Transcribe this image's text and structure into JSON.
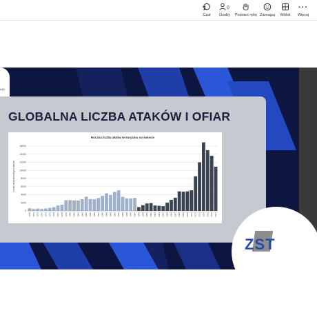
{
  "toolbar": {
    "items": [
      {
        "label": "Czat",
        "icon": "chat-icon"
      },
      {
        "label": "Osoby",
        "icon": "people-icon",
        "count": "0"
      },
      {
        "label": "Podnieś rękę",
        "icon": "raise-hand-icon"
      },
      {
        "label": "Zareaguj",
        "icon": "react-icon"
      },
      {
        "label": "Widok",
        "icon": "view-icon"
      },
      {
        "label": "Więcej",
        "icon": "more-icon"
      }
    ]
  },
  "slide": {
    "title": "GLOBALNA LICZBA ATAKÓW I OFIAR",
    "logo_text": "ZST",
    "side_text": "ALK"
  },
  "colors": {
    "slide_background": "#0d1640",
    "accent_blue": "#2b56d8",
    "panel": "#c7c9d1",
    "bar_light": "#9fb1c8",
    "bar_dark": "#3b4452"
  },
  "chart_data": {
    "type": "bar",
    "title": "Roczna liczba aktów terroryzmu na świecie",
    "ylabel": "Liczba zarejestrowanych ataków",
    "ylim": [
      0,
      17000
    ],
    "yticks": [
      0,
      2000,
      4000,
      6000,
      8000,
      10000,
      12000,
      14000,
      16000
    ],
    "categories": [
      "1970",
      "1971",
      "1972",
      "1973",
      "1974",
      "1975",
      "1976",
      "1977",
      "1978",
      "1979",
      "1980",
      "1981",
      "1982",
      "1983",
      "1984",
      "1985",
      "1986",
      "1987",
      "1988",
      "1989",
      "1990",
      "1991",
      "1992",
      "1994",
      "1995",
      "1996",
      "1997",
      "1998",
      "1999",
      "2000",
      "2001",
      "2002",
      "2003",
      "2004",
      "2005",
      "2006",
      "2007",
      "2008",
      "2009",
      "2010",
      "2011",
      "2012",
      "2013",
      "2014",
      "2015",
      "2016",
      "2017"
    ],
    "values": [
      650,
      470,
      570,
      470,
      580,
      740,
      920,
      1320,
      1520,
      2650,
      2660,
      2590,
      2540,
      2870,
      3500,
      2910,
      2860,
      3180,
      3700,
      4320,
      3890,
      4680,
      5070,
      3460,
      3080,
      3060,
      3200,
      930,
      1400,
      1820,
      1900,
      1330,
      1260,
      1170,
      2020,
      2740,
      3240,
      4810,
      4720,
      4820,
      5080,
      8520,
      11990,
      16900,
      14970,
      13590,
      10900
    ]
  }
}
